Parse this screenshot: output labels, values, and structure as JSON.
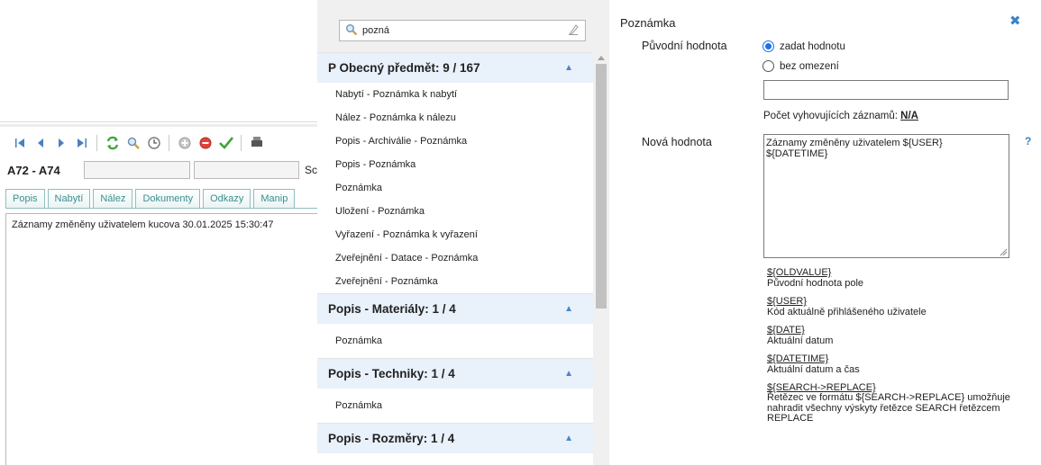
{
  "left": {
    "record_label": "A72 - A74",
    "record_tail": "Sc",
    "tabs": [
      "Popis",
      "Nabytí",
      "Nález",
      "Dokumenty",
      "Odkazy",
      "Manip"
    ],
    "memo_text": "Záznamy změněny uživatelem kucova 30.01.2025 15:30:47",
    "toolbar_icons": [
      "first-icon",
      "prev-icon",
      "next-icon",
      "last-icon",
      "refresh-icon",
      "search-icon",
      "clock-icon",
      "add-icon",
      "delete-icon",
      "check-icon",
      "print-icon"
    ]
  },
  "middle": {
    "search_value": "pozná",
    "groups": [
      {
        "title": "P Obecný předmět: 9 / 167",
        "items": [
          "Nabytí - Poznámka k nabytí",
          "Nález - Poznámka k nálezu",
          "Popis - Archiválie - Poznámka",
          "Popis - Poznámka",
          "Poznámka",
          "Uložení - Poznámka",
          "Vyřazení - Poznámka k vyřazení",
          "Zveřejnění - Datace - Poznámka",
          "Zveřejnění - Poznámka"
        ]
      },
      {
        "title": "Popis - Materiály: 1 / 4",
        "items": [
          "Poznámka"
        ]
      },
      {
        "title": "Popis - Techniky: 1 / 4",
        "items": [
          "Poznámka"
        ]
      },
      {
        "title": "Popis - Rozměry: 1 / 4",
        "items": []
      }
    ]
  },
  "right": {
    "title": "Poznámka",
    "close": "✖",
    "old_label": "Původní hodnota",
    "radio_set": "zadat hodnotu",
    "radio_unbounded": "bez omezení",
    "old_value": "",
    "count_label": "Počet vyhovujících záznamů:",
    "count_value": "N/A",
    "new_label": "Nová hodnota",
    "new_value": "Záznamy změněny uživatelem ${USER}\n${DATETIME}",
    "help": "?",
    "variables": [
      {
        "key": "${OLDVALUE}",
        "desc": "Původní hodnota pole"
      },
      {
        "key": "${USER}",
        "desc": "Kód aktuálně přihlášeného uživatele"
      },
      {
        "key": "${DATE}",
        "desc": "Aktuální datum"
      },
      {
        "key": "${DATETIME}",
        "desc": "Aktuální datum a čas"
      },
      {
        "key": "${SEARCH->REPLACE}",
        "desc": "Řetězec ve formátu ${SEARCH->REPLACE} umožňuje nahradit všechny výskyty řetězce SEARCH řetězcem REPLACE"
      }
    ]
  },
  "colors": {
    "accent": "#3a85c4",
    "tab_text": "#3c8f8e",
    "group_bg": "#e9f1fb"
  }
}
